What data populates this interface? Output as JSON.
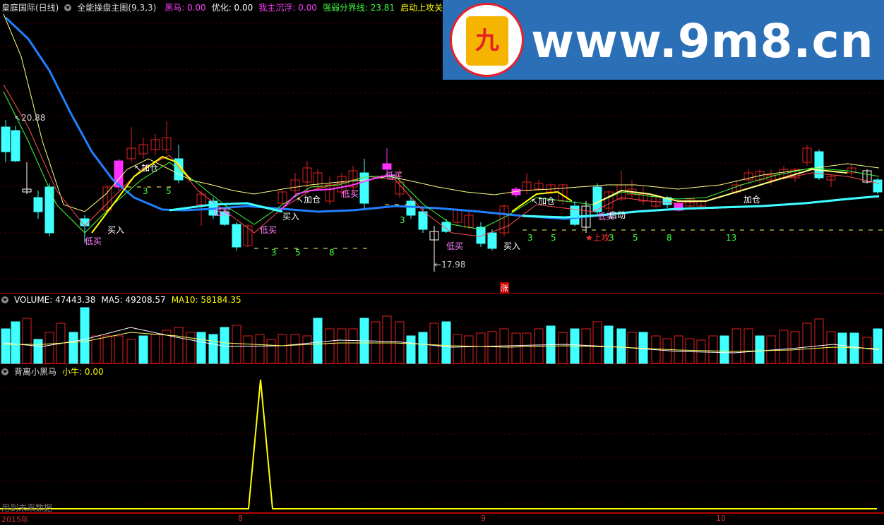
{
  "main": {
    "title": "皇庭国际(日线)",
    "indicator": "全能操盘主图(9,3,3)",
    "values": [
      {
        "label": "黑马: 0.00",
        "color": "#ff40ff"
      },
      {
        "label": "优化: 0.00",
        "color": "#ffffff"
      },
      {
        "label": "我主沉浮: 0.00",
        "color": "#ff40ff"
      },
      {
        "label": "强弱分界线: 23.81",
        "color": "#40ff40"
      },
      {
        "label": "启动上攻关注",
        "color": "#ffff00"
      }
    ],
    "high_label": "20.88",
    "low_label": "17.98",
    "signals": {
      "buy": "买入",
      "add": "加仓",
      "low_buy": "低买",
      "launch": "启动",
      "attack": "★上攻",
      "rise": "涨"
    },
    "counts": [
      "3",
      "5",
      "3",
      "5",
      "8",
      "3",
      "3",
      "5",
      "3",
      "5",
      "8",
      "13"
    ]
  },
  "volume": {
    "header": "VOLUME: 47443.38",
    "ma5": "MA5: 49208.57",
    "ma10": "MA10: 58184.35"
  },
  "indicator2": {
    "title": "背离小黑马",
    "value": "小牛: 0.00",
    "note": "用到未来数据"
  },
  "axis": {
    "year": "2015年",
    "months": [
      "8",
      "9",
      "10"
    ]
  },
  "watermark": {
    "url": "www.9m8.cn",
    "logo": "九"
  }
}
